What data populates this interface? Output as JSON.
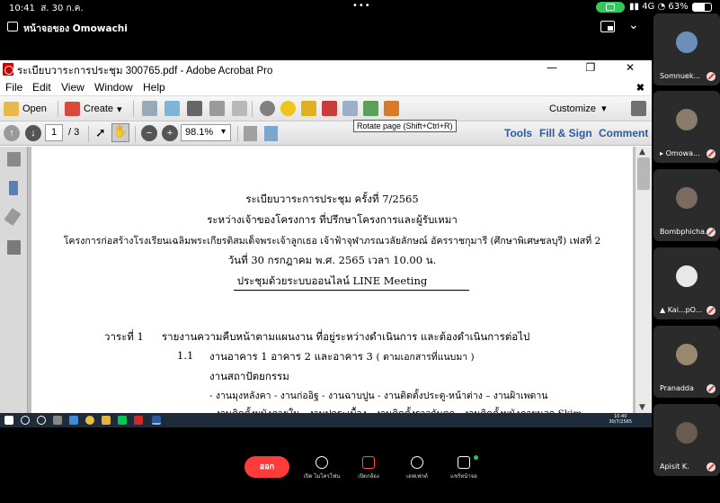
{
  "status_bar": {
    "time": "10:41",
    "date": "ส. 30 ก.ค.",
    "network": "4G",
    "battery": "63%",
    "battery_level": 0.63
  },
  "share_header": {
    "title": "หน้าจอของ Omowachi"
  },
  "acrobat": {
    "window_title": "ระเบียบวาระการประชุม 300765.pdf - Adobe Acrobat Pro",
    "menu": [
      "File",
      "Edit",
      "View",
      "Window",
      "Help"
    ],
    "toolbar": {
      "open_label": "Open",
      "create_label": "Create",
      "customize_label": "Customize"
    },
    "nav": {
      "page_current": "1",
      "page_total": "/ 3",
      "zoom": "98.1%"
    },
    "panel_links": [
      "Tools",
      "Fill & Sign",
      "Comment"
    ],
    "tooltip": "Rotate page (Shift+Ctrl+R)"
  },
  "document": {
    "title_lines": [
      "ระเบียบวาระการประชุม  ครั้งที่ 7/2565",
      "ระหว่างเจ้าของโครงการ ที่ปรึกษาโครงการและผู้รับเหมา",
      "โครงการก่อสร้างโรงเรียนเฉลิมพระเกียรติสมเด็จพระเจ้าลูกเธอ เจ้าฟ้าจุฬาภรณวลัยลักษณ์ อัครราชกุมารี (ศึกษาพิเศษชลบุรี) เฟสที่ 2",
      "วันที่  30  กรกฎาคม พ.ศ. 2565  เวลา  10.00  น.",
      "ประชุมด้วยระบบออนไลน์ LINE Meeting"
    ],
    "agenda_label": "วาระที่ 1",
    "agenda_text": "รายงานความคืบหน้าตามแผนงาน ที่อยู่ระหว่างดำเนินการ และต้องดำเนินการต่อไป",
    "item_number": "1.1",
    "item_text": "งานอาคาร 1 อาคาร 2 และอาคาร 3",
    "item_note": "( ตามเอกสารที่แนบมา )",
    "subhead": "งานสถาปัตยกรรม",
    "bullet_1": "- งานมุงหลังคา - งานก่ออิฐ - งานฉาบปูน - งานติดตั้งประตู-หน้าต่าง – งานฝ้าเพดาน",
    "bullet_2": "- งานติดตั้งผนังภายใน - งานปูกระเบื้อง - งานติดตั้งราวกันตก - งานติดตั้งผนังภายนอก Skim"
  },
  "taskbar": {
    "clock_time": "10:40",
    "clock_date": "30/7/2565"
  },
  "participants": [
    {
      "name": "Somnuek...",
      "color": "#6b8fb8"
    },
    {
      "name": "Omowa...",
      "color": "#8a7c6a"
    },
    {
      "name": "Bombphicha...",
      "color": "#7a6a60"
    },
    {
      "name": "Kai...pO...",
      "color": "#e8e8e8"
    },
    {
      "name": "Pranadda",
      "color": "#9a8770"
    },
    {
      "name": "Apisit K.",
      "color": "#6a5a50"
    }
  ],
  "controls": {
    "end_label": "ออก",
    "mic_label": "เปิด ไมโครโฟน",
    "camera_label": "เปิดกล้อง",
    "effect_label": "เอฟเฟกต์",
    "share_label": "แชร์หน้าจอ"
  }
}
